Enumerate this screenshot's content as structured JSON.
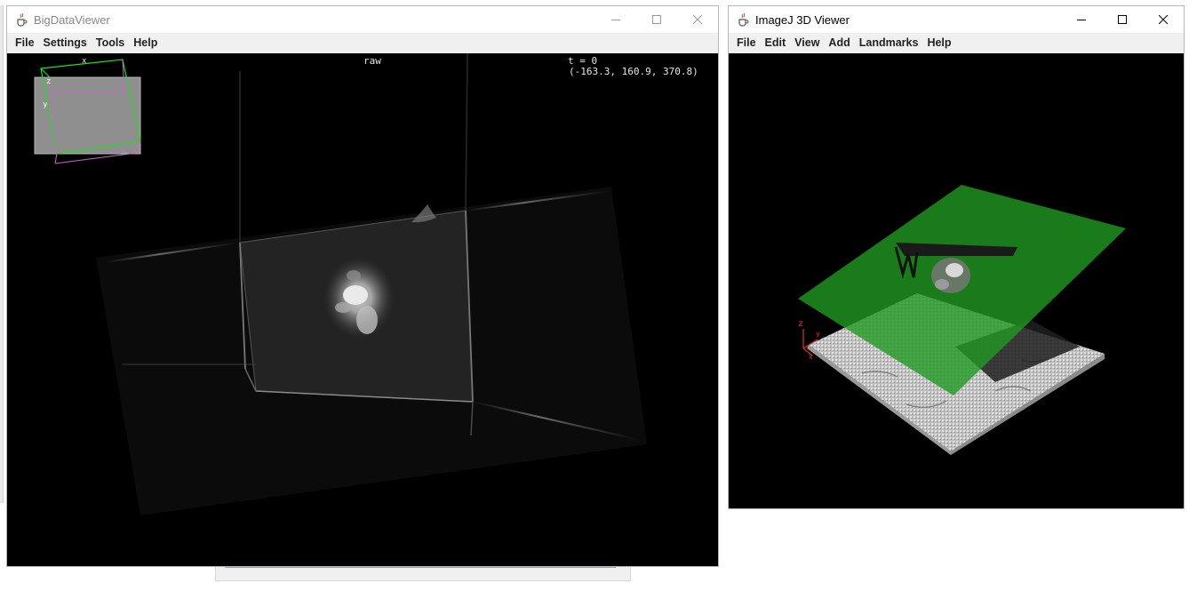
{
  "bdv": {
    "title": "BigDataViewer",
    "menu": [
      "File",
      "Settings",
      "Tools",
      "Help"
    ],
    "overlay": {
      "source": "raw",
      "time": "t = 0",
      "coords": "(-163.3, 160.9, 370.8)"
    },
    "box_axes": {
      "x": "x",
      "y": "y",
      "z": "z"
    }
  },
  "viewer3d": {
    "title": "ImageJ 3D Viewer",
    "menu": [
      "File",
      "Edit",
      "View",
      "Add",
      "Landmarks",
      "Help"
    ],
    "axes": {
      "x": "x",
      "y": "y",
      "z": "z"
    }
  },
  "colors": {
    "plane_green": "#1f9a1f",
    "axis_red": "#e03030",
    "box_green": "#22dd22",
    "box_magenta": "#cc66cc"
  },
  "icons": {
    "app": "java-cup-icon",
    "minimize": "minimize-icon",
    "maximize": "maximize-icon",
    "close": "close-icon"
  }
}
